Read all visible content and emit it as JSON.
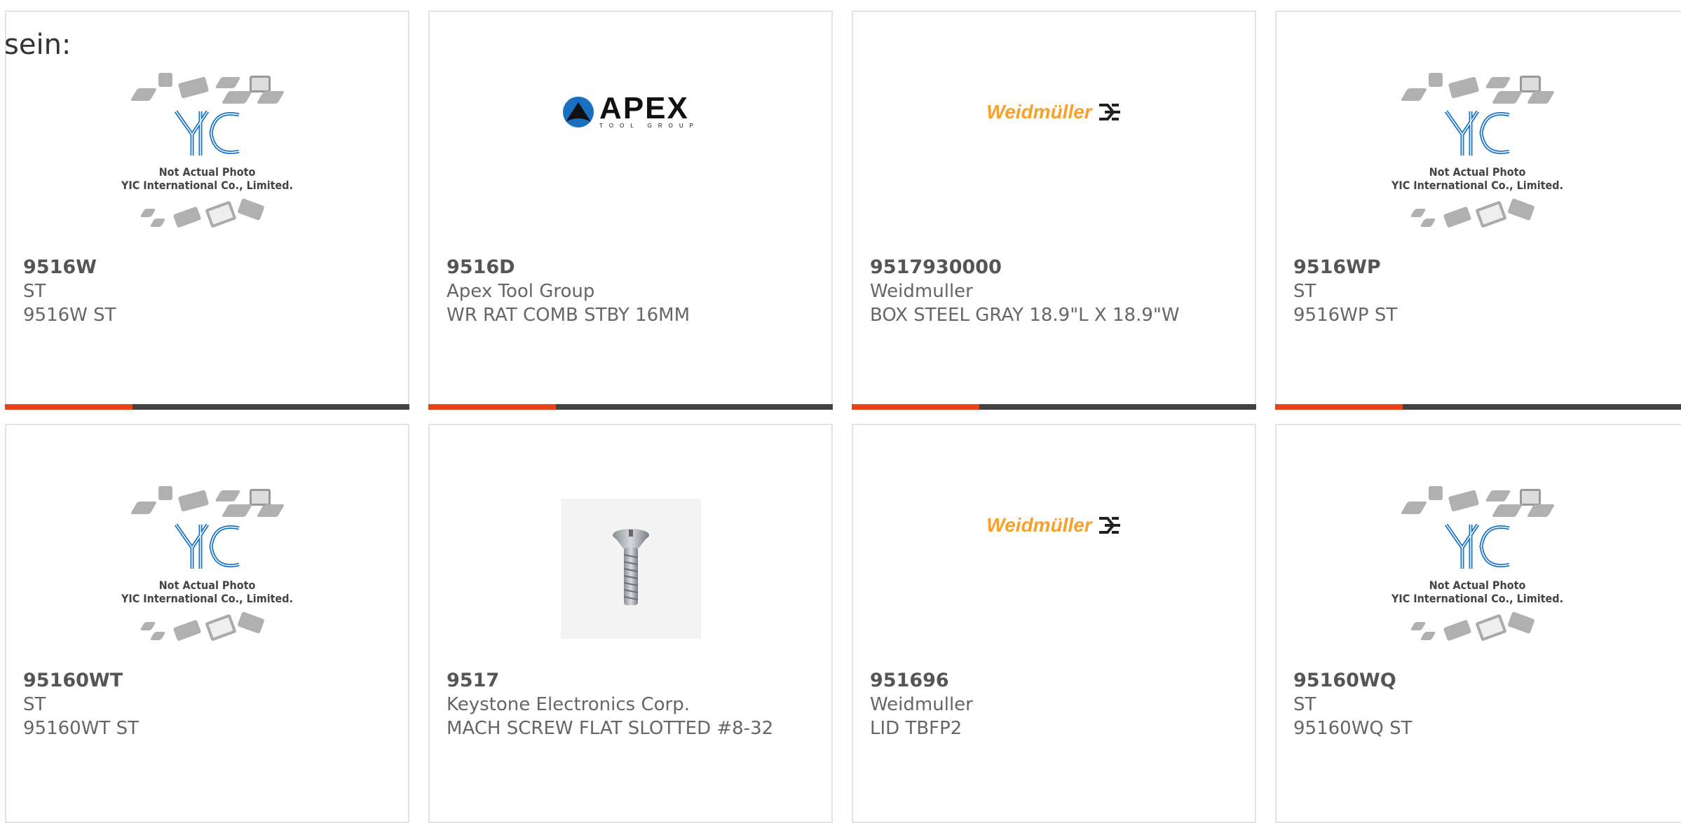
{
  "intro_text": "sein:",
  "placeholder": {
    "line1": "Not Actual Photo",
    "line2": "YIC International Co., Limited."
  },
  "brand": {
    "apex": "APEX",
    "apex_sub": "TOOL GROUP",
    "weidmuller": "Weidmüller"
  },
  "colors": {
    "accent": "#e8421a",
    "bar": "#424242",
    "text": "#666666"
  },
  "products": [
    {
      "part": "9516W",
      "manufacturer": "ST",
      "description": "9516W ST",
      "image": "yic-placeholder"
    },
    {
      "part": "9516D",
      "manufacturer": "Apex Tool Group",
      "description": "WR RAT COMB STBY 16MM",
      "image": "apex-logo"
    },
    {
      "part": "9517930000",
      "manufacturer": "Weidmuller",
      "description": "BOX STEEL GRAY 18.9\"L X 18.9\"W",
      "image": "weidmuller-logo"
    },
    {
      "part": "9516WP",
      "manufacturer": "ST",
      "description": "9516WP ST",
      "image": "yic-placeholder"
    },
    {
      "part": "95160WT",
      "manufacturer": "ST",
      "description": "95160WT ST",
      "image": "yic-placeholder"
    },
    {
      "part": "9517",
      "manufacturer": "Keystone Electronics Corp.",
      "description": "MACH SCREW FLAT SLOTTED #8-32",
      "image": "screw-photo"
    },
    {
      "part": "951696",
      "manufacturer": "Weidmuller",
      "description": "LID TBFP2",
      "image": "weidmuller-logo"
    },
    {
      "part": "95160WQ",
      "manufacturer": "ST",
      "description": "95160WQ ST",
      "image": "yic-placeholder"
    }
  ]
}
